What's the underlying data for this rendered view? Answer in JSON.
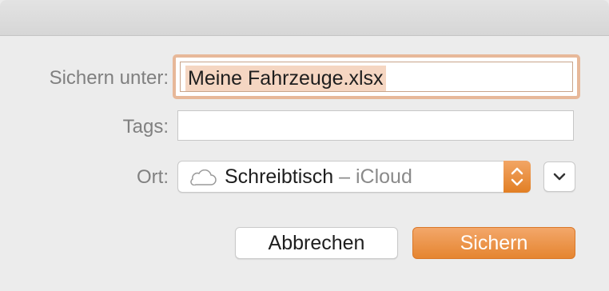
{
  "form": {
    "save_as_label": "Sichern unter:",
    "save_as_value": "Meine Fahrzeuge.xlsx",
    "tags_label": "Tags:",
    "tags_value": "",
    "location_label": "Ort:",
    "location_name": "Schreibtisch",
    "location_sub": " – iCloud",
    "location_icon": "cloud-icon",
    "expand_icon": "chevron-down-icon"
  },
  "buttons": {
    "cancel_label": "Abbrechen",
    "save_label": "Sichern"
  },
  "colors": {
    "accent": "#e58530",
    "selection": "#f5d6c2",
    "focus_ring": "#e7b899"
  }
}
